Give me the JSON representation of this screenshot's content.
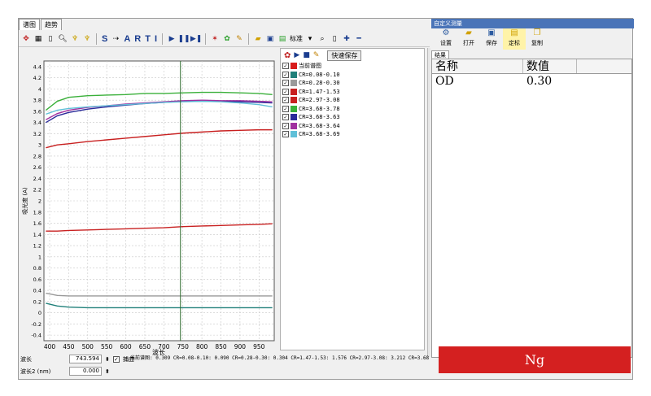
{
  "tabs": [
    {
      "label": "谱图",
      "active": true
    },
    {
      "label": "趋势",
      "active": false
    }
  ],
  "toolbar": {
    "text_tools": [
      "S",
      "A",
      "R",
      "T",
      "I"
    ],
    "standard_label": "标准",
    "icons": [
      "crosshair-icon",
      "grid-icon",
      "document-icon",
      "zoom-icon",
      "pin-icon",
      "pin2-icon",
      "select-icon",
      "play-icon",
      "pause-icon",
      "step-icon",
      "settings-icon",
      "palette-icon",
      "folder-icon",
      "save-icon",
      "export-icon",
      "search-icon",
      "page-icon",
      "plus-icon",
      "minus-icon"
    ]
  },
  "legend": {
    "quick_save": "快速保存",
    "items": [
      {
        "label": "当前谱图",
        "color": "#d81c1c",
        "checked": true
      },
      {
        "label": "CR=0.08-0.10",
        "color": "#20807a",
        "checked": true
      },
      {
        "label": "CR=0.28-0.30",
        "color": "#9a9a9a",
        "checked": true
      },
      {
        "label": "CR=1.47-1.53",
        "color": "#c82020",
        "checked": true
      },
      {
        "label": "CR=2.97-3.08",
        "color": "#c82020",
        "checked": true
      },
      {
        "label": "CR=3.68-3.78",
        "color": "#3ab03a",
        "checked": true
      },
      {
        "label": "CR=3.68-3.63",
        "color": "#2a2a9a",
        "checked": true
      },
      {
        "label": "CR=3.68-3.64",
        "color": "#a030a0",
        "checked": true
      },
      {
        "label": "CR=3.68-3.69",
        "color": "#60c0d8",
        "checked": true
      }
    ]
  },
  "chart_data": {
    "type": "line",
    "xlabel": "波长",
    "ylabel": "吸光度 (A)",
    "xlim": [
      385,
      990
    ],
    "ylim": [
      -0.5,
      4.5
    ],
    "xticks": [
      400,
      450,
      500,
      550,
      600,
      650,
      700,
      750,
      800,
      850,
      900,
      950
    ],
    "yticks": [
      -0.4,
      -0.2,
      0,
      0.2,
      0.4,
      0.6,
      0.8,
      1,
      1.2,
      1.4,
      1.6,
      1.8,
      2,
      2.2,
      2.4,
      2.6,
      2.8,
      3,
      3.2,
      3.4,
      3.6,
      3.8,
      4,
      4.2,
      4.4
    ],
    "cursor_x": 743.594,
    "grid": true,
    "x": [
      390,
      420,
      450,
      500,
      550,
      600,
      650,
      700,
      750,
      800,
      850,
      900,
      950,
      985
    ],
    "series": [
      {
        "name": "CR=0.08-0.10",
        "color": "#20807a",
        "values": [
          0.17,
          0.12,
          0.1,
          0.09,
          0.09,
          0.09,
          0.09,
          0.09,
          0.09,
          0.09,
          0.09,
          0.09,
          0.09,
          0.09
        ]
      },
      {
        "name": "CR=0.28-0.30",
        "color": "#9a9a9a",
        "values": [
          0.35,
          0.31,
          0.3,
          0.3,
          0.3,
          0.3,
          0.3,
          0.3,
          0.3,
          0.3,
          0.3,
          0.3,
          0.3,
          0.3
        ]
      },
      {
        "name": "CR=1.47-1.53",
        "color": "#c82020",
        "values": [
          1.46,
          1.46,
          1.47,
          1.48,
          1.49,
          1.5,
          1.51,
          1.52,
          1.54,
          1.55,
          1.56,
          1.57,
          1.58,
          1.59
        ]
      },
      {
        "name": "CR=2.97-3.08",
        "color": "#c82020",
        "values": [
          2.95,
          3.0,
          3.02,
          3.06,
          3.09,
          3.12,
          3.15,
          3.18,
          3.21,
          3.23,
          3.25,
          3.26,
          3.27,
          3.27
        ]
      },
      {
        "name": "CR=3.68-3.63",
        "color": "#2a2a9a",
        "values": [
          3.4,
          3.52,
          3.58,
          3.64,
          3.68,
          3.71,
          3.74,
          3.76,
          3.78,
          3.78,
          3.78,
          3.77,
          3.76,
          3.75
        ]
      },
      {
        "name": "CR=3.68-3.64",
        "color": "#a030a0",
        "values": [
          3.45,
          3.56,
          3.62,
          3.67,
          3.7,
          3.73,
          3.75,
          3.77,
          3.79,
          3.8,
          3.79,
          3.79,
          3.78,
          3.77
        ]
      },
      {
        "name": "CR=3.68-3.69",
        "color": "#60c0d8",
        "values": [
          3.55,
          3.62,
          3.65,
          3.68,
          3.7,
          3.72,
          3.74,
          3.76,
          3.77,
          3.78,
          3.77,
          3.75,
          3.72,
          3.68
        ]
      },
      {
        "name": "CR=3.68-3.78",
        "color": "#3ab03a",
        "values": [
          3.62,
          3.78,
          3.85,
          3.88,
          3.89,
          3.9,
          3.92,
          3.92,
          3.93,
          3.94,
          3.94,
          3.93,
          3.92,
          3.9
        ]
      }
    ]
  },
  "status": {
    "wavelength_label": "波长",
    "wavelength_value": "743.594",
    "capture_label": "捕曲",
    "wavelength2_label": "波长2 (nm)",
    "wavelength2_value": "0.000",
    "readout": "当前谱图: 0.309  CR=0.08-0.10: 0.090  CR=0.28-0.30: 0.304  CR=1.47-1.53: 1.576  CR=2.97-3.08: 3.212  CR=3.68"
  },
  "right_panel": {
    "title": "自定义测量",
    "buttons": [
      {
        "label": "设置",
        "icon": "gear-icon"
      },
      {
        "label": "打开",
        "icon": "folder-open-icon"
      },
      {
        "label": "保存",
        "icon": "save-icon"
      },
      {
        "label": "定标",
        "icon": "calibrate-icon"
      },
      {
        "label": "复制",
        "icon": "copy-icon"
      }
    ],
    "results_tab": "结果",
    "table": {
      "headers": [
        "名称",
        "数值"
      ],
      "rows": [
        [
          "OD",
          "0.30"
        ]
      ]
    },
    "result_banner": "Ng",
    "banner_color": "#d42020"
  }
}
